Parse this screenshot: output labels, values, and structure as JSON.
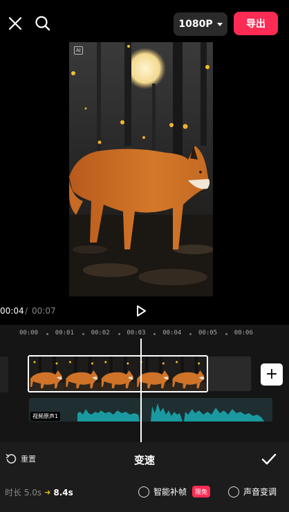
{
  "topbar": {
    "close_icon": "close-icon",
    "search_icon": "search-icon",
    "resolution": "1080P",
    "export_label": "导出"
  },
  "preview": {
    "ai_badge": "AI"
  },
  "playback": {
    "current_time": "00:04",
    "separator": "/",
    "total_time": "00:07",
    "play_icon": "play-icon"
  },
  "timeline": {
    "ruler": [
      "00:00",
      "00:01",
      "00:02",
      "00:03",
      "00:04",
      "00:05",
      "00:06"
    ],
    "audio_label": "视频原声1",
    "add_icon": "plus-icon"
  },
  "speed_panel": {
    "reset_label": "重置",
    "title": "变速",
    "confirm_icon": "check-icon",
    "duration_label": "时长 5.0s",
    "duration_new": "8.4s",
    "smart_frame_label": "智能补帧",
    "free_badge": "限免",
    "voice_change_label": "声音变调"
  },
  "colors": {
    "accent": "#fe2c55",
    "arrow": "#e5c200"
  }
}
